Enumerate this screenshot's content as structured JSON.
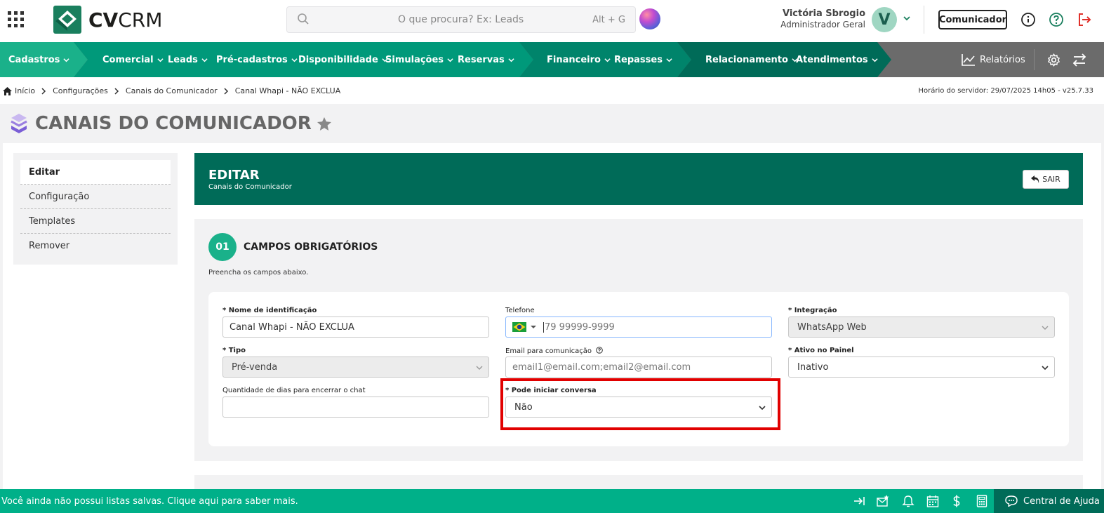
{
  "header": {
    "logo_text_bold": "CV",
    "logo_text_light": "CRM",
    "search_placeholder": "O que procura? Ex: Leads",
    "search_shortcut": "Alt + G",
    "user_name": "Victória Sbrogio",
    "user_role": "Administrador Geral",
    "avatar_letter": "V",
    "comunicador_label": "Comunicador"
  },
  "nav": {
    "items": [
      {
        "label": "Cadastros"
      },
      {
        "label": "Comercial"
      },
      {
        "label": "Leads"
      },
      {
        "label": "Pré-cadastros"
      },
      {
        "label": "Disponibilidade"
      },
      {
        "label": "Simulações"
      },
      {
        "label": "Reservas"
      },
      {
        "label": "Financeiro"
      },
      {
        "label": "Repasses"
      },
      {
        "label": "Relacionamento"
      },
      {
        "label": "Atendimentos"
      },
      {
        "label": "Relatórios"
      }
    ],
    "colors": {
      "seg1": "#1ab18a",
      "seg2": "#00997a",
      "seg3": "#00846b",
      "seg4": "#006b58",
      "rest": "#6b6b6b"
    }
  },
  "breadcrumb": {
    "items": [
      "Início",
      "Configurações",
      "Canais do Comunicador",
      "Canal Whapi - NÃO EXCLUA"
    ],
    "server_time": "Horário do servidor: 29/07/2025 14h05 - v25.7.33"
  },
  "page": {
    "title": "CANAIS DO COMUNICADOR"
  },
  "side_menu": {
    "items": [
      "Editar",
      "Configuração",
      "Templates",
      "Remover"
    ]
  },
  "card": {
    "title": "EDITAR",
    "subtitle": "Canais do Comunicador",
    "exit_label": "SAIR"
  },
  "section": {
    "step": "01",
    "title": "CAMPOS OBRIGATÓRIOS",
    "description": "Preencha os campos abaixo."
  },
  "form": {
    "nome_label": "* Nome de identificação",
    "nome_value": "Canal Whapi - NÃO EXCLUA",
    "telefone_label": "Telefone",
    "telefone_placeholder": "79 99999-9999",
    "integracao_label": "* Integração",
    "integracao_value": "WhatsApp Web",
    "tipo_label": "* Tipo",
    "tipo_value": "Pré-venda",
    "email_label": "Email para comunicação",
    "email_placeholder": "email1@email.com;email2@email.com",
    "ativo_label": "* Ativo no Painel",
    "ativo_value": "Inativo",
    "dias_label": "Quantidade de dias para encerrar o chat",
    "dias_value": "",
    "iniciar_label": "* Pode iniciar conversa",
    "iniciar_value": "Não"
  },
  "footer": {
    "message": "Você ainda não possui listas salvas. Clique aqui para saber mais.",
    "help_label": "Central de Ajuda"
  }
}
